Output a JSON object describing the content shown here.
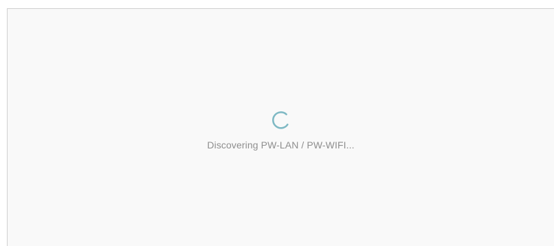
{
  "loader": {
    "status_text": "Discovering PW-LAN / PW-WIFI...",
    "spinner_icon": "loading-spinner-icon",
    "spinner_color": "#7fb9c4"
  }
}
